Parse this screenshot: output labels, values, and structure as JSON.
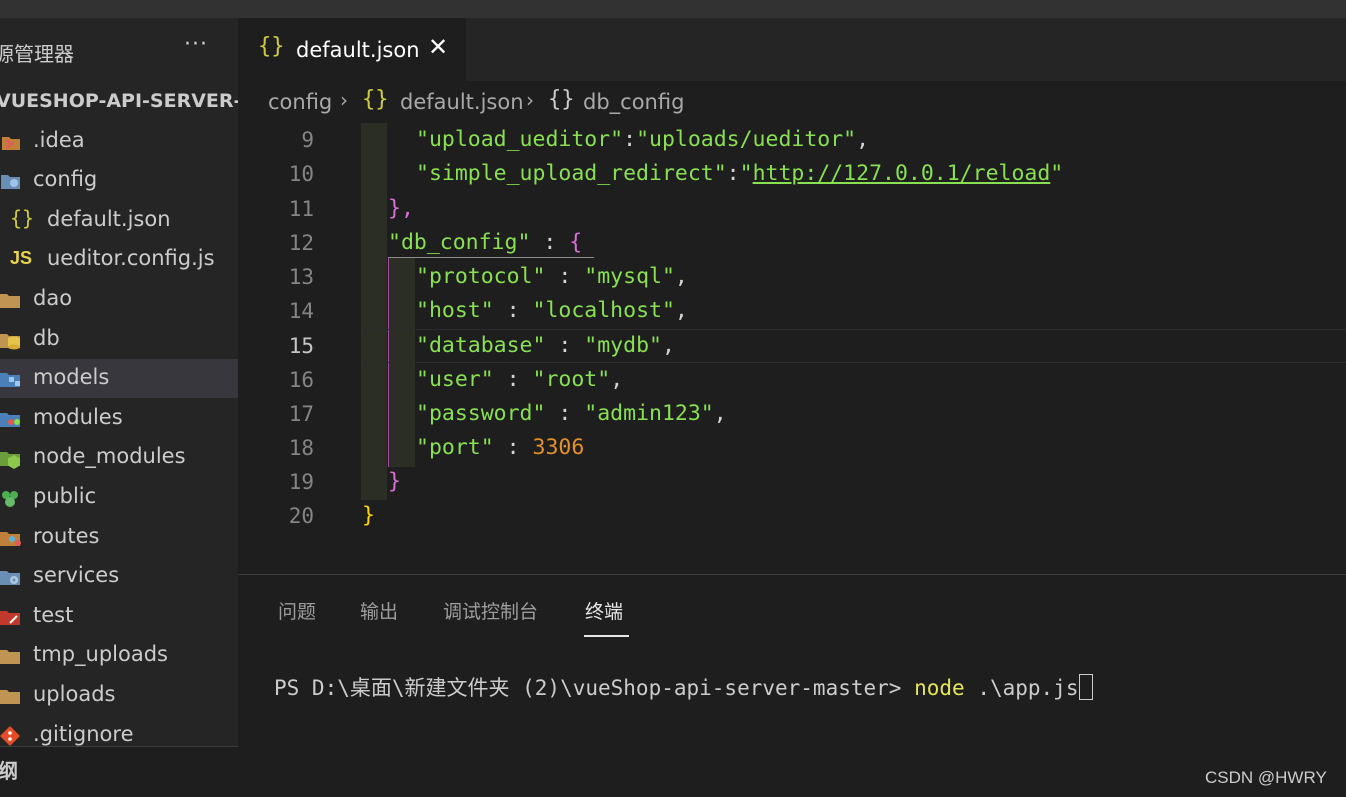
{
  "sidebar": {
    "title": "源管理器",
    "more": "···",
    "project": "VUESHOP-API-SERVER-M...",
    "items": [
      {
        "label": ".idea",
        "icon": "idea-folder-icon"
      },
      {
        "label": "config",
        "icon": "config-folder-icon"
      },
      {
        "label": "default.json",
        "icon": "json-file-icon"
      },
      {
        "label": "ueditor.config.js",
        "icon": "js-file-icon",
        "badge": "JS"
      },
      {
        "label": "dao",
        "icon": "folder-icon"
      },
      {
        "label": "db",
        "icon": "database-folder-icon"
      },
      {
        "label": "models",
        "icon": "models-folder-icon"
      },
      {
        "label": "modules",
        "icon": "modules-folder-icon"
      },
      {
        "label": "node_modules",
        "icon": "node-folder-icon"
      },
      {
        "label": "public",
        "icon": "public-folder-icon"
      },
      {
        "label": "routes",
        "icon": "routes-folder-icon"
      },
      {
        "label": "services",
        "icon": "services-folder-icon"
      },
      {
        "label": "test",
        "icon": "test-folder-icon"
      },
      {
        "label": "tmp_uploads",
        "icon": "folder-icon"
      },
      {
        "label": "uploads",
        "icon": "folder-icon"
      },
      {
        "label": ".gitignore",
        "icon": "git-icon"
      }
    ],
    "selected": "models",
    "footer": "纲"
  },
  "tab": {
    "label": "default.json",
    "icon": "{}",
    "close": "✕"
  },
  "breadcrumb": {
    "folder": "config",
    "file": "default.json",
    "symbol": "db_config",
    "sep": "›",
    "icon": "{}"
  },
  "editor": {
    "line_numbers": [
      "9",
      "10",
      "11",
      "12",
      "13",
      "14",
      "15",
      "16",
      "17",
      "18",
      "19",
      "20"
    ],
    "active_line": "15",
    "lines": {
      "l9_key": "\"upload_ueditor\"",
      "l9_val": "\"uploads/ueditor\"",
      "l10_key": "\"simple_upload_redirect\"",
      "l10_val": "http://127.0.0.1/reload",
      "l11": "},",
      "l12_key": "\"db_config\"",
      "l12_brace": "{",
      "l13_key": "\"protocol\"",
      "l13_val": "\"mysql\"",
      "l14_key": "\"host\"",
      "l14_val": "\"localhost\"",
      "l15_key": "\"database\"",
      "l15_val": "\"mydb\"",
      "l16_key": "\"user\"",
      "l16_val": "\"root\"",
      "l17_key": "\"password\"",
      "l17_val": "\"admin123\"",
      "l18_key": "\"port\"",
      "l18_val": "3306",
      "l19": "}",
      "l20": "}"
    }
  },
  "panel": {
    "tabs": [
      "问题",
      "输出",
      "调试控制台",
      "终端"
    ],
    "active_tab": "终端",
    "prompt": "PS D:\\桌面\\新建文件夹 (2)\\vueShop-api-server-master> ",
    "command": "node",
    "args": " .\\app.js"
  },
  "watermark": "CSDN @HWRY",
  "colors": {
    "background": "#1e1e1e",
    "sidebar": "#252526",
    "string_green": "#89e051",
    "key_blue": "#9cdcfe",
    "number_orange": "#e5902a",
    "bracket_magenta": "#da70d6",
    "bracket_yellow": "#ffd700"
  }
}
